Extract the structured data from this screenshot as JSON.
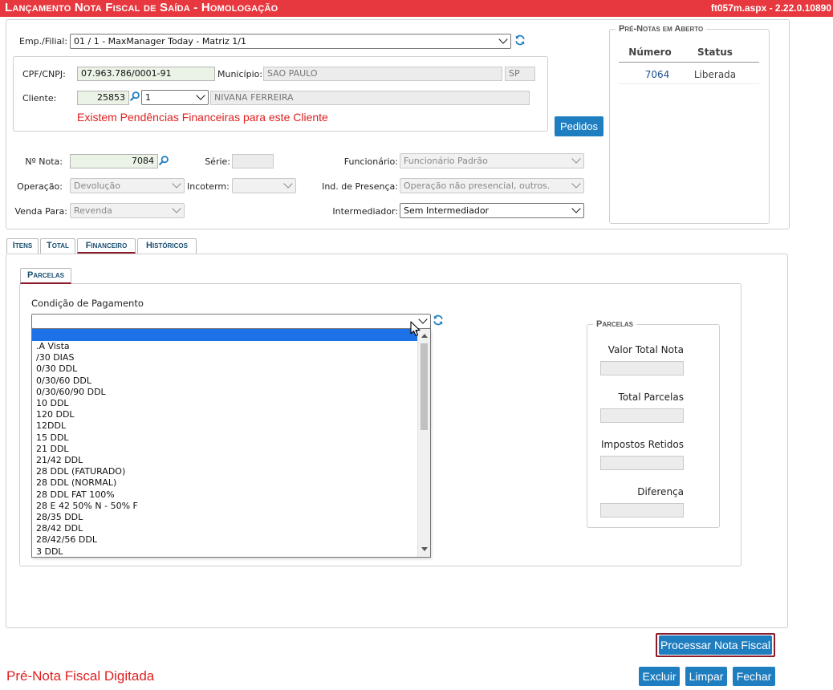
{
  "header": {
    "title": "Lançamento Nota Fiscal de Saída  - Homologação",
    "version": "ft057m.aspx - 2.22.0.10890"
  },
  "empresa": {
    "label": "Emp./Filial:",
    "value": "01 / 1 - MaxManager Today - Matriz 1/1"
  },
  "cliente_box": {
    "cpf_label": "CPF/CNPJ:",
    "cpf_value": "07.963.786/0001-91",
    "municipio_label": "Município:",
    "municipio_value": "SAO PAULO",
    "uf_value": "SP",
    "cliente_label": "Cliente:",
    "cliente_code": "25853",
    "cliente_seq": "1",
    "cliente_name": "NIVANA FERREIRA",
    "warning": "Existem Pendências Financeiras para este Cliente"
  },
  "pedidos_button": "Pedidos",
  "nota": {
    "numero_label": "Nº Nota:",
    "numero_value": "7084",
    "serie_label": "Série:",
    "serie_value": "",
    "funcionario_label": "Funcionário:",
    "funcionario_value": "Funcionário Padrão",
    "operacao_label": "Operação:",
    "operacao_value": "Devolução",
    "incoterm_label": "Incoterm:",
    "incoterm_value": "",
    "presenca_label": "Ind. de Presença:",
    "presenca_value": "Operação não presencial, outros.",
    "venda_label": "Venda Para:",
    "venda_value": "Revenda",
    "intermediador_label": "Intermediador:",
    "intermediador_value": "Sem Intermediador"
  },
  "pre_notas": {
    "legend": "Pré-Notas em Aberto",
    "columns": [
      "Número",
      "Status"
    ],
    "rows": [
      [
        "7064",
        "Liberada"
      ]
    ]
  },
  "tabs": [
    "Itens",
    "Total",
    "Financeiro",
    "Históricos"
  ],
  "active_tab": "Financeiro",
  "subtab": "Parcelas",
  "financeiro": {
    "condicao_label": "Condição de Pagamento",
    "condicao_value": "",
    "options": [
      ".A Vista",
      "/30 DIAS",
      "0/30 DDL",
      "0/30/60 DDL",
      "0/30/60/90 DDL",
      "10 DDL",
      "120 DDL",
      "12DDL",
      "15 DDL",
      "21 DDL",
      "21/42 DDL",
      "28 DDL (FATURADO)",
      "28 DDL (NORMAL)",
      "28 DDL FAT 100%",
      "28 E 42 50% N - 50% F",
      "28/35 DDL",
      "28/42 DDL",
      "28/42/56 DDL",
      "3 DDL"
    ],
    "parcelas_legend": "Parcelas",
    "valor_total_label": "Valor Total Nota",
    "total_parcelas_label": "Total Parcelas",
    "impostos_label": "Impostos Retidos",
    "diferenca_label": "Diferença"
  },
  "buttons": {
    "processar": "Processar Nota Fiscal",
    "excluir": "Excluir",
    "limpar": "Limpar",
    "fechar": "Fechar"
  },
  "status_text": "Pré-Nota Fiscal Digitada",
  "colors": {
    "title_bar": "#e8383f",
    "button": "#1f7ec0",
    "warning": "#e02020",
    "tab_accent": "#8b1a2b",
    "dropdown_highlight": "#1e72e8"
  }
}
